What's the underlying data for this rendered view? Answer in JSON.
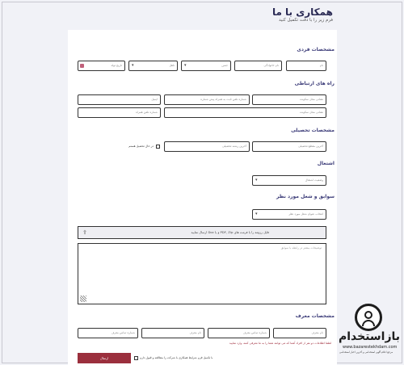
{
  "header": {
    "title": "همکاری با ما",
    "subtitle": "فرم زیر را با دقت تکمیل کنید"
  },
  "sections": {
    "personal": "مشخصات فردی",
    "contact": "راه های ارتباطی",
    "education": "مشخصات تحصیلی",
    "employment": "اشتغال",
    "history": "سوابق و شغل مورد نظر",
    "references": "مشخصات معرف"
  },
  "personal": {
    "first_name": "نام",
    "last_name": "نام خانوادگی",
    "gender": "جنس",
    "marital": "تاهل",
    "birthdate": "تاریخ تولد"
  },
  "contact": {
    "address": "نشانی محل سکونت",
    "phone_home": "شماره تلفن ثابت به همراه پیش شماره",
    "email": "ایمیل",
    "mobile": "شماره تلفن همراه"
  },
  "education": {
    "level": "آخرین مقطع تحصیلی",
    "field": "آخرین رشته تحصیلی",
    "studying_label": "در حال تحصیل هستم"
  },
  "employment": {
    "status": "وضعیت اشتغال"
  },
  "history": {
    "job_select": "انتخاب عنوان شغل مورد نظر",
    "upload_text": "فایل رزومه را با فرمت های PDF, Zip و یا Doc ارسال نمایید",
    "textarea_placeholder": "توضیحات بیشتر در رابطه با سوابق"
  },
  "references": {
    "ref1_name": "نام معرف",
    "ref1_phone": "شماره تماس معرف",
    "ref2_name": "نام معرف",
    "ref2_phone": "شماره تماس معرف",
    "note": "لطفا اطلاعات دو نفر از افراد آشنا که می توانند شما را به ما معرفی کنند، وارد نمایید"
  },
  "footer": {
    "terms_label": "با تکمیل فرم شرایط همکاری با شرکت را مطالعه و قبول دارم",
    "submit_label": "ارسال"
  },
  "watermark": {
    "name": "بازاستخدام",
    "url": "www.bazarestekhdam.com",
    "tagline": "مرجع اعلام آگهی استخدامی و آخرین اخبار استخدامی"
  },
  "colors": {
    "accent": "#9b2f3d",
    "heading": "#3b3b78",
    "background": "#f1f2f7"
  }
}
